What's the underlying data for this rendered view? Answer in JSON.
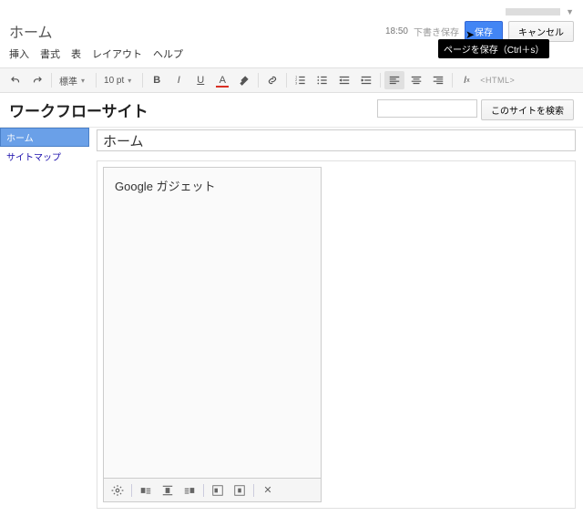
{
  "header": {
    "page_name": "ホーム",
    "time": "18:50",
    "draft_saved": "下書き保存",
    "save": "保存",
    "cancel": "キャンセル",
    "tooltip": "ページを保存（Ctrl＋s）"
  },
  "menus": {
    "insert": "挿入",
    "format": "書式",
    "table": "表",
    "layout": "レイアウト",
    "help": "ヘルプ"
  },
  "toolbar": {
    "style": "標準",
    "size": "10 pt",
    "html": "<HTML>"
  },
  "site": {
    "title": "ワークフローサイト",
    "search_btn": "このサイトを検索"
  },
  "sidebar": {
    "items": [
      "ホーム",
      "サイトマップ"
    ]
  },
  "page": {
    "title_value": "ホーム",
    "gadget_label": "Google ガジェット"
  }
}
